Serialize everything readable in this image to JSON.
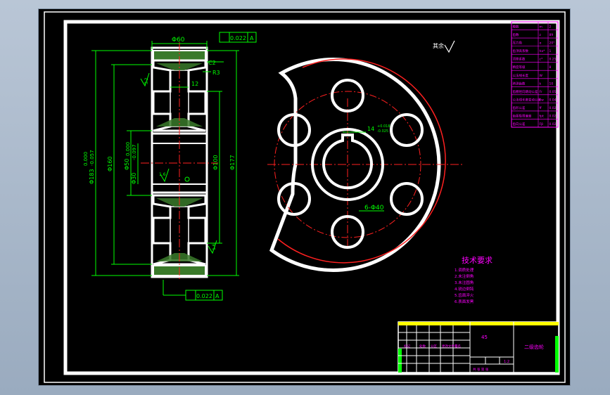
{
  "drawing": {
    "tech_req_title": "技术要求",
    "tech_req_lines": [
      "1.调质处理",
      "2.未注倒角",
      "3.未注圆角",
      "4.锐边倒钝",
      "5.齿面淬火",
      "6.表面发黑"
    ],
    "roughness_note": "其余",
    "section_dims": {
      "d60": "Φ60",
      "tol1": "0.022",
      "datum": "A",
      "chamfer": "C2",
      "radius": "R3",
      "width": "12",
      "d183": "Φ183",
      "d183_tol_upper": "0.000",
      "d183_tol_lower": "-0.057",
      "d160": "Φ160",
      "d50": "Φ50",
      "d30": "Φ30",
      "d30_tol_upper": "0.000",
      "d30_tol_lower": "-0.097",
      "d100": "Φ100",
      "d177": "Φ177",
      "tol2": "0.022",
      "ra_top": "3.2",
      "ra_left": "1.6",
      "ra_right": "1.6"
    },
    "front_dims": {
      "keyway": "14",
      "keyway_tol_upper": "+0.018",
      "keyway_tol_lower": "-0.025",
      "holes": "6-Φ40"
    },
    "title_block": {
      "part_name": "二级齿轮",
      "material": "45",
      "scale": "1:2",
      "labels": [
        "标记",
        "处数",
        "分区",
        "更改文件号",
        "签名",
        "年月日",
        "设计",
        "标准化",
        "阶段标记",
        "重量",
        "比例",
        "审核",
        "工艺",
        "批准",
        "共 张 第 张"
      ]
    },
    "param_table": {
      "rows": [
        [
          "模数",
          "m",
          "2"
        ],
        [
          "齿数",
          "z",
          "89"
        ],
        [
          "压力角",
          "α",
          "20°"
        ],
        [
          "齿顶高系数",
          "ha*",
          "1"
        ],
        [
          "顶隙系数",
          "c*",
          "0.25"
        ],
        [
          "精度等级",
          "",
          "8"
        ],
        [
          "公法线长度",
          "W",
          ""
        ],
        [
          "跨测齿数",
          "k",
          "10"
        ],
        [
          "齿圈径向跳动公差",
          "Fr",
          "0.05"
        ],
        [
          "公法线长度变动公差",
          "Fw",
          "0.04"
        ],
        [
          "齿形公差",
          "ff",
          "0.02"
        ],
        [
          "齿距极限偏差",
          "fpt",
          "0.02"
        ],
        [
          "齿向公差",
          "Fβ",
          "0.02"
        ]
      ]
    }
  },
  "colors": {
    "background": "#000000",
    "outline": "#ffffff",
    "dimension": "#00ff00",
    "centerline": "#ff2020",
    "text": "#ff00ff",
    "border": "#ffffff",
    "title_accent": "#ffff00"
  }
}
